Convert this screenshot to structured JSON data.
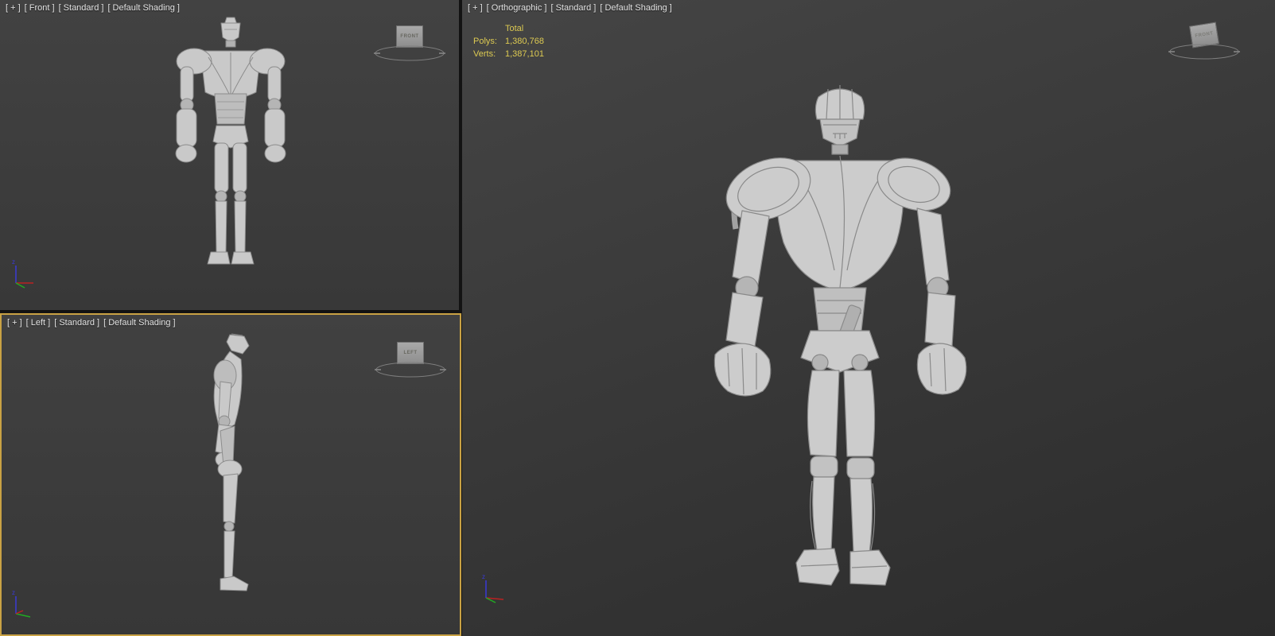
{
  "colors": {
    "active_viewport_border": "#c9a244",
    "stats_text": "#ddca52",
    "viewport_label_text": "#e3e3e3",
    "axis_x": "#bb2222",
    "axis_y": "#22aa22",
    "axis_z": "#3a3ad6",
    "model_fill": "#c9c9c9"
  },
  "viewports": {
    "front": {
      "menu_general": "[ + ]",
      "menu_view": "[ Front ]",
      "menu_renderer": "[ Standard ]",
      "menu_shading": "[ Default Shading ]",
      "viewcube_label": "FRONT"
    },
    "left": {
      "menu_general": "[ + ]",
      "menu_view": "[ Left ]",
      "menu_renderer": "[ Standard ]",
      "menu_shading": "[ Default Shading ]",
      "viewcube_label": "LEFT"
    },
    "ortho": {
      "menu_general": "[ + ]",
      "menu_view": "[ Orthographic ]",
      "menu_renderer": "[ Standard ]",
      "menu_shading": "[ Default Shading ]",
      "viewcube_label": "FRONT",
      "statistics": {
        "total_label": "Total",
        "polys_label": "Polys:",
        "polys_value": "1,380,768",
        "verts_label": "Verts:",
        "verts_value": "1,387,101"
      }
    }
  },
  "axis": {
    "z": "z"
  }
}
